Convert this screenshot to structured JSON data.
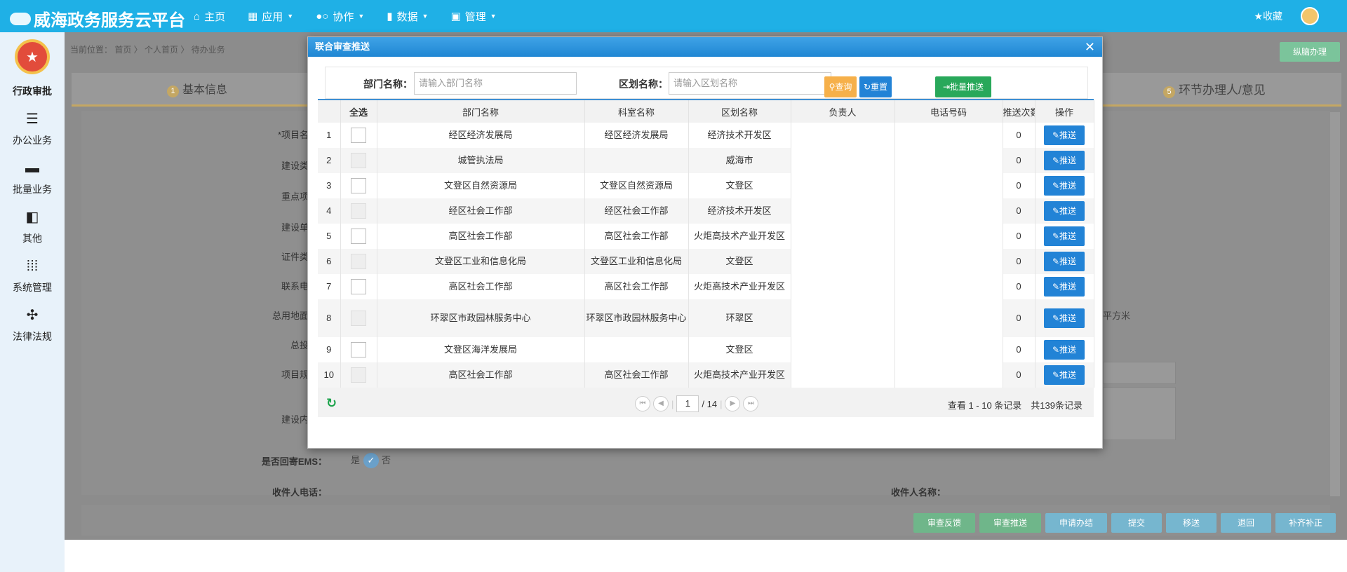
{
  "topbar": {
    "logo_text": "威海政务服务云平台",
    "menu": [
      {
        "icon": "home-icon",
        "label": "主页",
        "caret": false
      },
      {
        "icon": "grid-icon",
        "label": "应用",
        "caret": true
      },
      {
        "icon": "collab-icon",
        "label": "协作",
        "caret": true
      },
      {
        "icon": "bar-chart-icon",
        "label": "数据",
        "caret": true
      },
      {
        "icon": "dashboard-icon",
        "label": "管理",
        "caret": true
      }
    ],
    "favorite_label": "收藏"
  },
  "sidebar": {
    "title": "行政审批",
    "items": [
      {
        "icon": "list-icon",
        "label": "办公业务"
      },
      {
        "icon": "folder-icon",
        "label": "批量业务"
      },
      {
        "icon": "twitter-icon",
        "label": "其他"
      },
      {
        "icon": "apps-icon",
        "label": "系统管理"
      },
      {
        "icon": "sitemap-icon",
        "label": "法律法规"
      }
    ]
  },
  "background": {
    "breadcrumb": "当前位置： 首页 〉 个人首页 〉 待办业务",
    "full_handle_label": "纵脑办理",
    "step1_num": "1",
    "step1_label": "基本信息",
    "step5_num": "5",
    "step5_label": "环节办理人/意见",
    "labels": [
      "*项目名",
      "建设类",
      "重点项",
      "建设单",
      "证件类",
      "联系电",
      "总用地面",
      "总投",
      "项目规",
      "建设内"
    ],
    "ems_label": "是否回寄EMS：",
    "ems_yes": "是",
    "ems_no": "否",
    "unit_sqm": "平方米",
    "receiver_phone_label": "收件人电话：",
    "receiver_name_label": "收件人名称：",
    "actions": [
      "审查反馈",
      "审查推送",
      "申请办结",
      "提交",
      "移送",
      "退回",
      "补齐补正"
    ]
  },
  "dialog": {
    "title": "联合审查推送",
    "dept_label": "部门名称：",
    "dept_placeholder": "请输入部门名称",
    "district_label": "区划名称：",
    "district_placeholder": "请输入区划名称",
    "search_btn": "查询",
    "reset_btn": "重置",
    "batch_btn": "批量推送",
    "columns": [
      "全选",
      "部门名称",
      "科室名称",
      "区划名称",
      "负责人",
      "电话号码",
      "推送次数",
      "操作"
    ],
    "rows": [
      {
        "no": "1",
        "dept": "经区经济发展局",
        "office": "经区经济发展局",
        "district": "经济技术开发区",
        "leader": "",
        "phone": "",
        "count": "0",
        "action": "推送"
      },
      {
        "no": "2",
        "dept": "城管执法局",
        "office": "",
        "district": "威海市",
        "leader": "",
        "phone": "",
        "count": "0",
        "action": "推送"
      },
      {
        "no": "3",
        "dept": "文登区自然资源局",
        "office": "文登区自然资源局",
        "district": "文登区",
        "leader": "",
        "phone": "",
        "count": "0",
        "action": "推送"
      },
      {
        "no": "4",
        "dept": "经区社会工作部",
        "office": "经区社会工作部",
        "district": "经济技术开发区",
        "leader": "",
        "phone": "",
        "count": "0",
        "action": "推送"
      },
      {
        "no": "5",
        "dept": "高区社会工作部",
        "office": "高区社会工作部",
        "district": "火炬高技术产业开发区",
        "leader": "",
        "phone": "",
        "count": "0",
        "action": "推送"
      },
      {
        "no": "6",
        "dept": "文登区工业和信息化局",
        "office": "文登区工业和信息化局",
        "district": "文登区",
        "leader": "",
        "phone": "",
        "count": "0",
        "action": "推送"
      },
      {
        "no": "7",
        "dept": "高区社会工作部",
        "office": "高区社会工作部",
        "district": "火炬高技术产业开发区",
        "leader": "",
        "phone": "",
        "count": "0",
        "action": "推送"
      },
      {
        "no": "8",
        "dept": "环翠区市政园林服务中心",
        "office": "环翠区市政园林服务中心",
        "district": "环翠区",
        "leader": "",
        "phone": "",
        "count": "0",
        "action": "推送"
      },
      {
        "no": "9",
        "dept": "文登区海洋发展局",
        "office": "",
        "district": "文登区",
        "leader": "",
        "phone": "",
        "count": "0",
        "action": "推送"
      },
      {
        "no": "10",
        "dept": "高区社会工作部",
        "office": "高区社会工作部",
        "district": "火炬高技术产业开发区",
        "leader": "",
        "phone": "",
        "count": "0",
        "action": "推送"
      }
    ],
    "pager": {
      "page": "1",
      "total_pages": "/ 14",
      "info": "查看 1 - 10 条记录　共139条记录"
    }
  }
}
